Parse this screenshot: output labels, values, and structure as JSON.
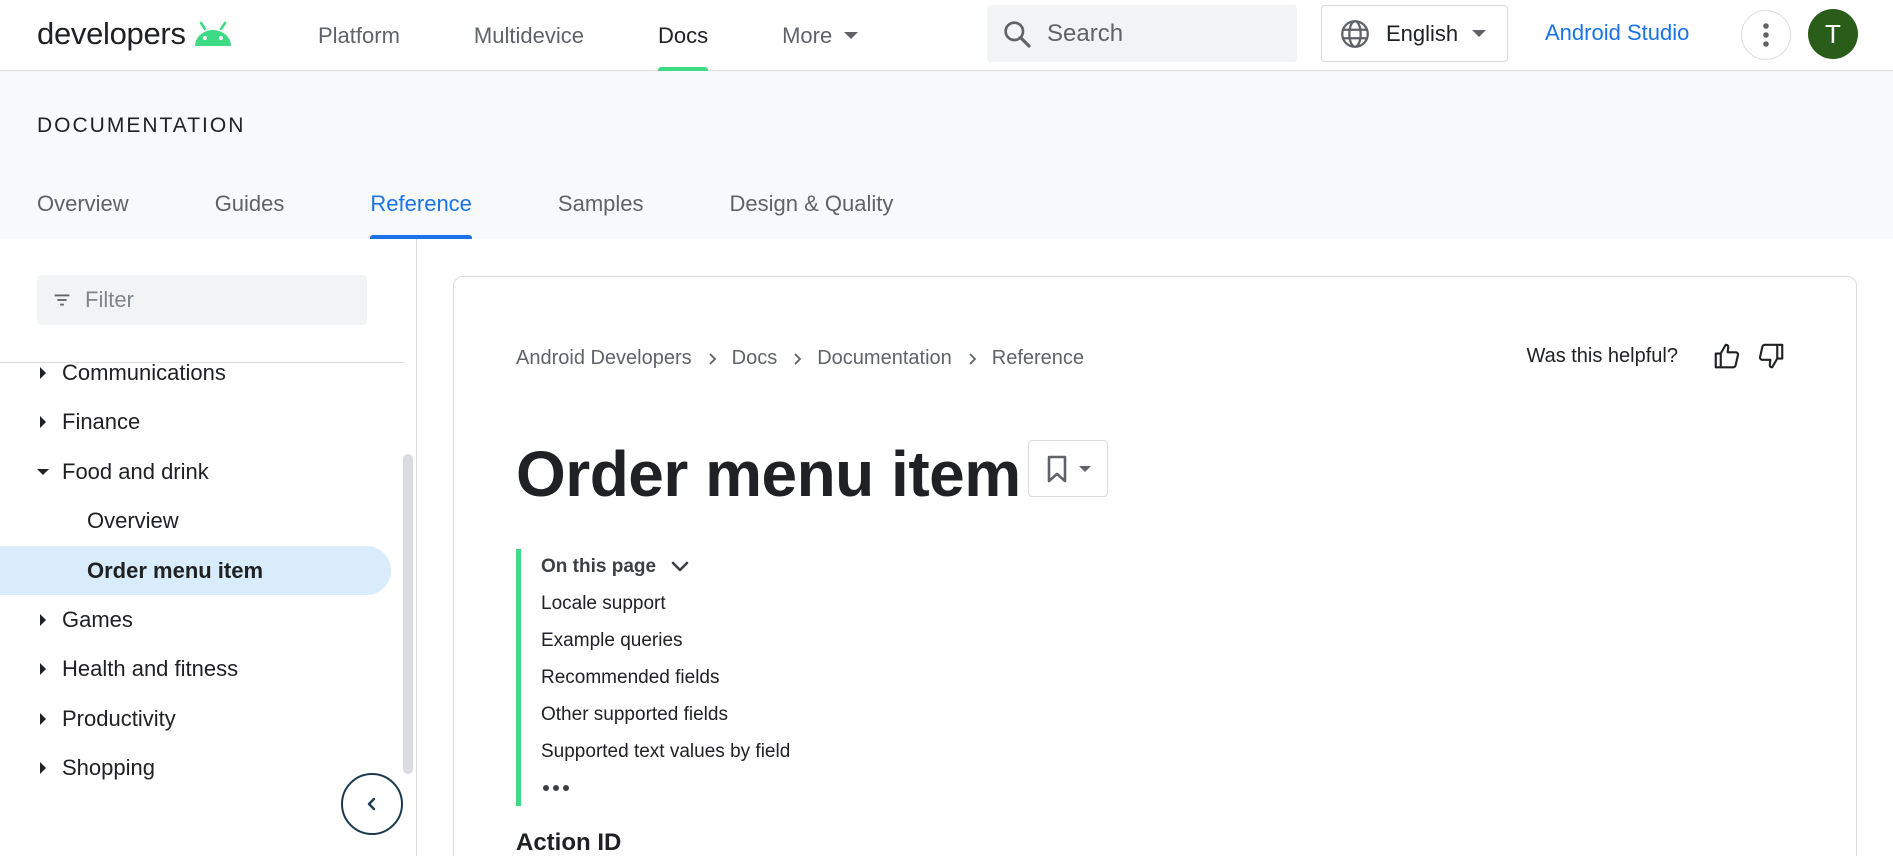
{
  "header": {
    "logo_text": "developers",
    "nav": [
      "Platform",
      "Multidevice",
      "Docs",
      "More"
    ],
    "search_placeholder": "Search",
    "language": "English",
    "studio_link": "Android Studio",
    "avatar_initial": "T"
  },
  "section": {
    "title": "DOCUMENTATION",
    "tabs": [
      "Overview",
      "Guides",
      "Reference",
      "Samples",
      "Design & Quality"
    ]
  },
  "sidebar": {
    "filter_placeholder": "Filter",
    "items": [
      {
        "label": "Communications"
      },
      {
        "label": "Finance"
      },
      {
        "label": "Food and drink"
      },
      {
        "label": "Overview"
      },
      {
        "label": "Order menu item"
      },
      {
        "label": "Games"
      },
      {
        "label": "Health and fitness"
      },
      {
        "label": "Productivity"
      },
      {
        "label": "Shopping"
      }
    ]
  },
  "main": {
    "breadcrumb": [
      "Android Developers",
      "Docs",
      "Documentation",
      "Reference"
    ],
    "helpful_text": "Was this helpful?",
    "title": "Order menu item",
    "toc": {
      "heading": "On this page",
      "items": [
        "Locale support",
        "Example queries",
        "Recommended fields",
        "Other supported fields",
        "Supported text values by field"
      ]
    },
    "first_section": "Action ID"
  },
  "colors": {
    "android_green": "#3ddc84",
    "link_blue": "#1a73e8",
    "avatar_bg": "#2a5d1a",
    "selected_bg": "#d9ecfb"
  }
}
